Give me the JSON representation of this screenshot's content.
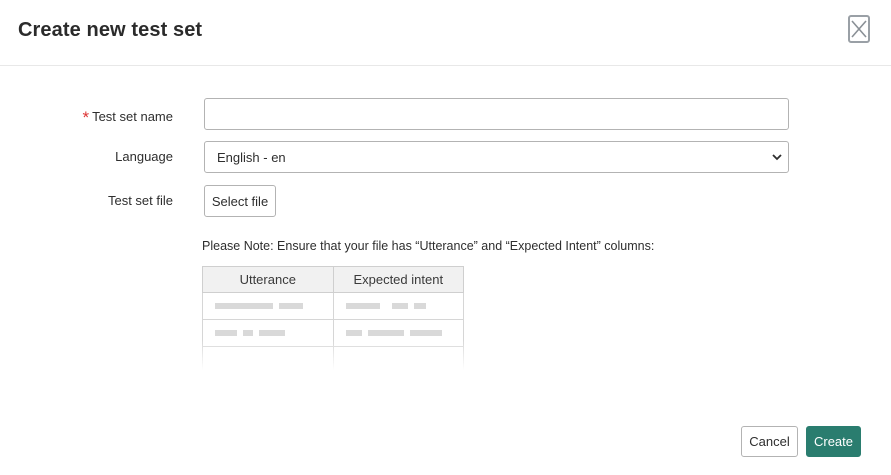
{
  "dialog": {
    "title": "Create new test set",
    "close_icon": "close-x-icon"
  },
  "form": {
    "name_label": "Test set name",
    "required_mark": "*",
    "name_value": "",
    "name_placeholder": "",
    "language_label": "Language",
    "language_value": "English - en",
    "file_label": "Test set file",
    "file_button": "Select file"
  },
  "note": {
    "text": "Please Note: Ensure that your file has “Utterance” and “Expected Intent” columns:",
    "table_headers": [
      "Utterance",
      "Expected intent"
    ]
  },
  "footer": {
    "cancel_label": "Cancel",
    "create_label": "Create"
  },
  "colors": {
    "primary": "#2a7d6f",
    "required": "#dd3333",
    "border": "#b3b3b3"
  }
}
